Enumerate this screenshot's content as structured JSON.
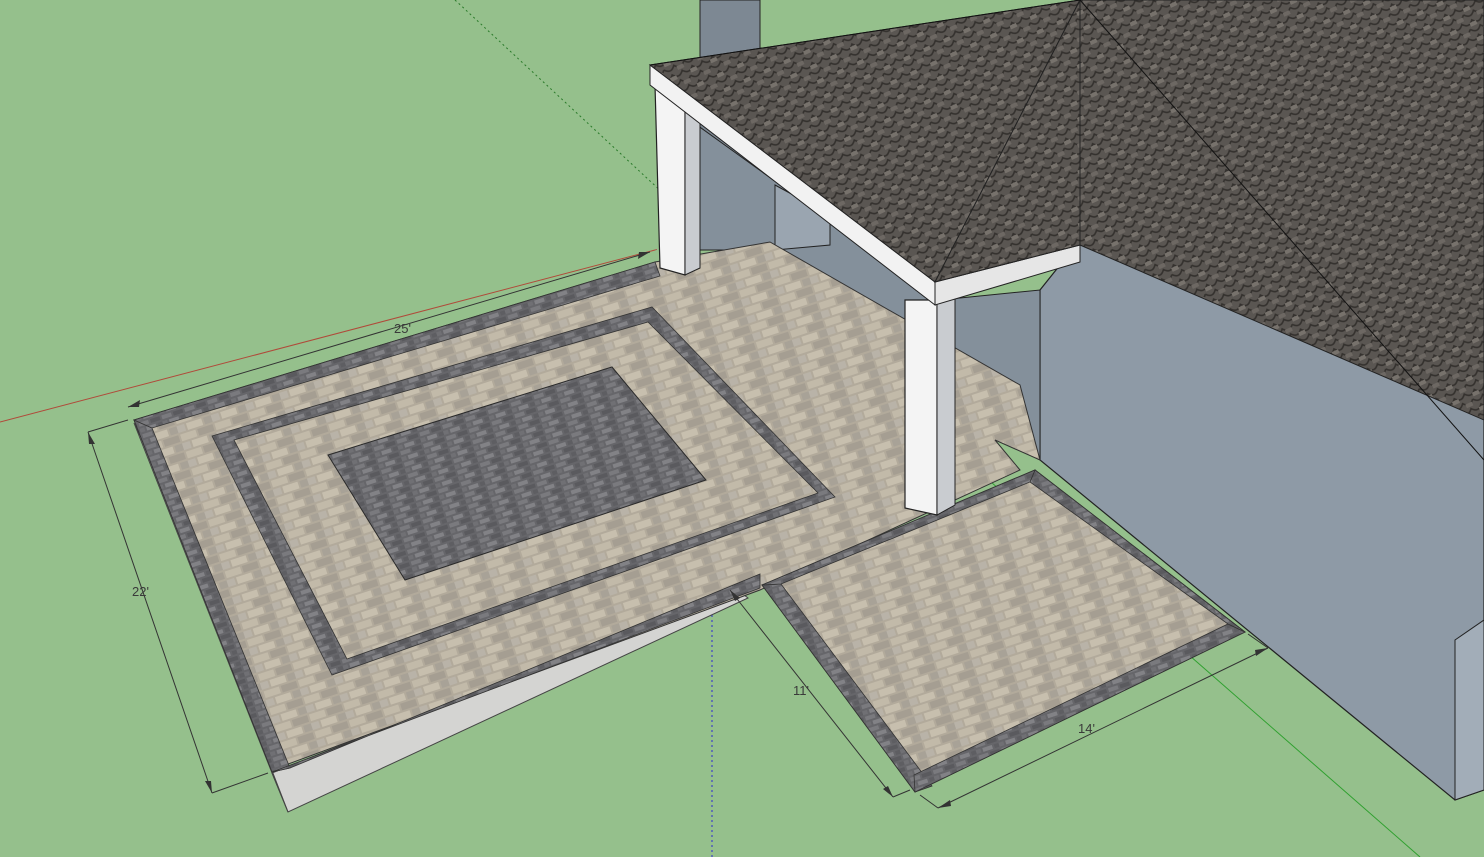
{
  "scene": {
    "ground_color": "#95c08c",
    "paver_light": "#b3ab9c",
    "paver_dark": "#6e6e72",
    "border_dark": "#5d5d61",
    "roof_color": "#5d5955",
    "wall_color": "#8e9aa6",
    "post_color": "#f4f4f4",
    "axis_red": "#b04a3a",
    "axis_green": "#2fa02f",
    "axis_blue": "#2a2ad0"
  },
  "dimensions": {
    "width_main": "25'",
    "depth_main": "22'",
    "depth_side": "11'",
    "width_side": "14'"
  }
}
